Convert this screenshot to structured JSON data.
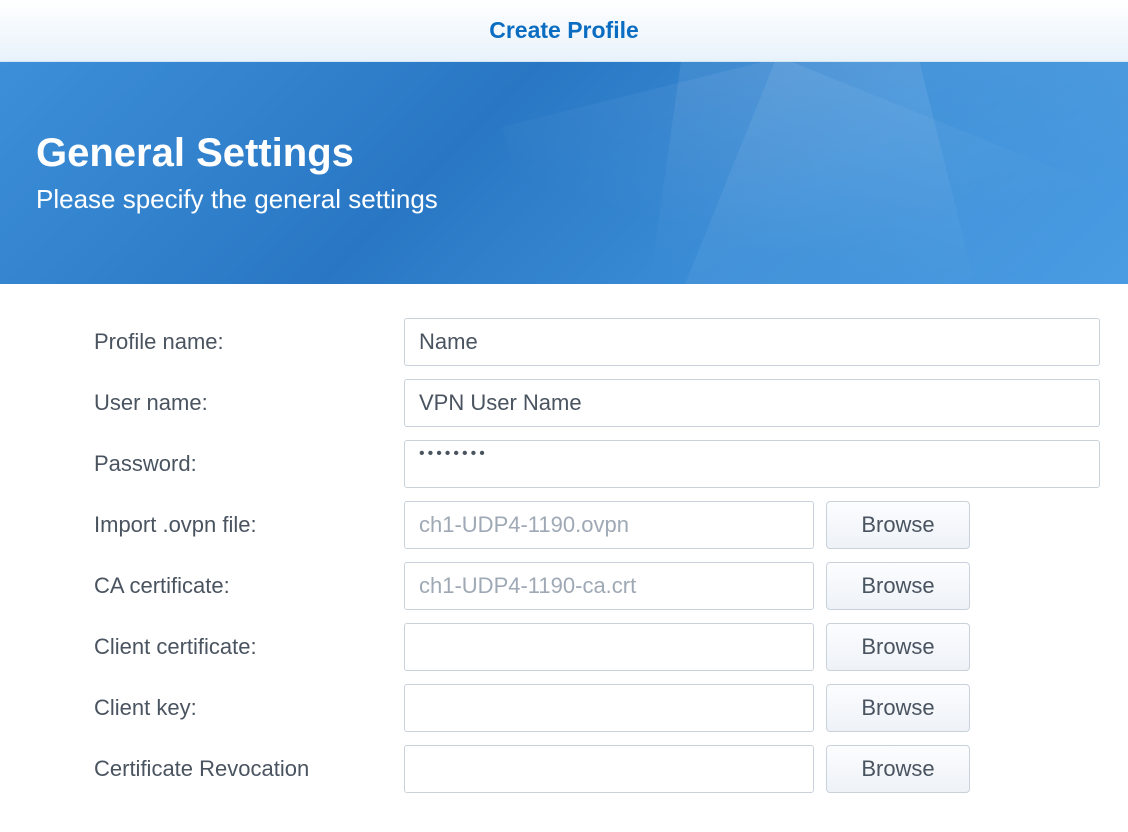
{
  "titlebar": {
    "title": "Create Profile"
  },
  "banner": {
    "title": "General Settings",
    "subtitle": "Please specify the general settings"
  },
  "form": {
    "profile_name": {
      "label": "Profile name:",
      "value": "Name"
    },
    "user_name": {
      "label": "User name:",
      "value": "VPN User Name"
    },
    "password": {
      "label": "Password:",
      "value": "••••••••"
    },
    "ovpn": {
      "label": "Import .ovpn file:",
      "value": "ch1-UDP4-1190.ovpn",
      "button": "Browse"
    },
    "ca_cert": {
      "label": "CA certificate:",
      "value": "ch1-UDP4-1190-ca.crt",
      "button": "Browse"
    },
    "client_cert": {
      "label": "Client certificate:",
      "value": "",
      "button": "Browse"
    },
    "client_key": {
      "label": "Client key:",
      "value": "",
      "button": "Browse"
    },
    "crl": {
      "label": "Certificate Revocation",
      "value": "",
      "button": "Browse"
    }
  }
}
